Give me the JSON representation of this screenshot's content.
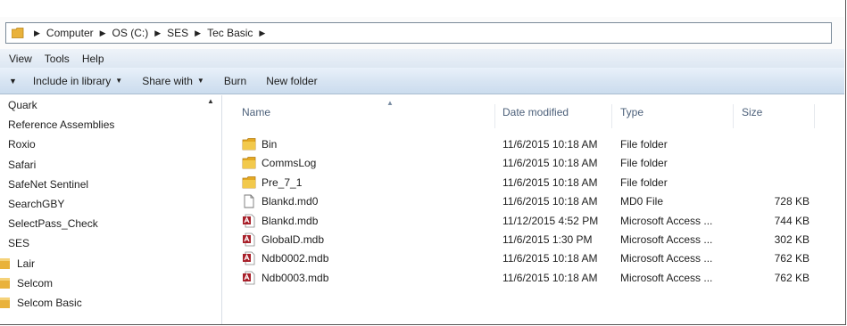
{
  "breadcrumb": [
    "Computer",
    "OS (C:)",
    "SES",
    "Tec Basic"
  ],
  "menu": [
    "View",
    "Tools",
    "Help"
  ],
  "toolbar": {
    "include_library": "Include in library",
    "share_with": "Share with",
    "burn": "Burn",
    "new_folder": "New folder"
  },
  "nav": [
    {
      "label": "Quark",
      "folder": false
    },
    {
      "label": "Reference Assemblies",
      "folder": false
    },
    {
      "label": "Roxio",
      "folder": false
    },
    {
      "label": "Safari",
      "folder": false
    },
    {
      "label": "SafeNet Sentinel",
      "folder": false
    },
    {
      "label": "SearchGBY",
      "folder": false
    },
    {
      "label": "SelectPass_Check",
      "folder": false
    },
    {
      "label": "SES",
      "folder": false
    },
    {
      "label": "Lair",
      "folder": true
    },
    {
      "label": "Selcom",
      "folder": true
    },
    {
      "label": "Selcom Basic",
      "folder": true
    }
  ],
  "columns": {
    "name": "Name",
    "date": "Date modified",
    "type": "Type",
    "size": "Size"
  },
  "files": [
    {
      "name": "Bin",
      "date": "11/6/2015 10:18 AM",
      "type": "File folder",
      "size": "",
      "icon": "folder"
    },
    {
      "name": "CommsLog",
      "date": "11/6/2015 10:18 AM",
      "type": "File folder",
      "size": "",
      "icon": "folder"
    },
    {
      "name": "Pre_7_1",
      "date": "11/6/2015 10:18 AM",
      "type": "File folder",
      "size": "",
      "icon": "folder"
    },
    {
      "name": "Blankd.md0",
      "date": "11/6/2015 10:18 AM",
      "type": "MD0 File",
      "size": "728 KB",
      "icon": "file"
    },
    {
      "name": "Blankd.mdb",
      "date": "11/12/2015 4:52 PM",
      "type": "Microsoft Access ...",
      "size": "744 KB",
      "icon": "access"
    },
    {
      "name": "GlobalD.mdb",
      "date": "11/6/2015 1:30 PM",
      "type": "Microsoft Access ...",
      "size": "302 KB",
      "icon": "access"
    },
    {
      "name": "Ndb0002.mdb",
      "date": "11/6/2015 10:18 AM",
      "type": "Microsoft Access ...",
      "size": "762 KB",
      "icon": "access"
    },
    {
      "name": "Ndb0003.mdb",
      "date": "11/6/2015 10:18 AM",
      "type": "Microsoft Access ...",
      "size": "762 KB",
      "icon": "access"
    }
  ]
}
